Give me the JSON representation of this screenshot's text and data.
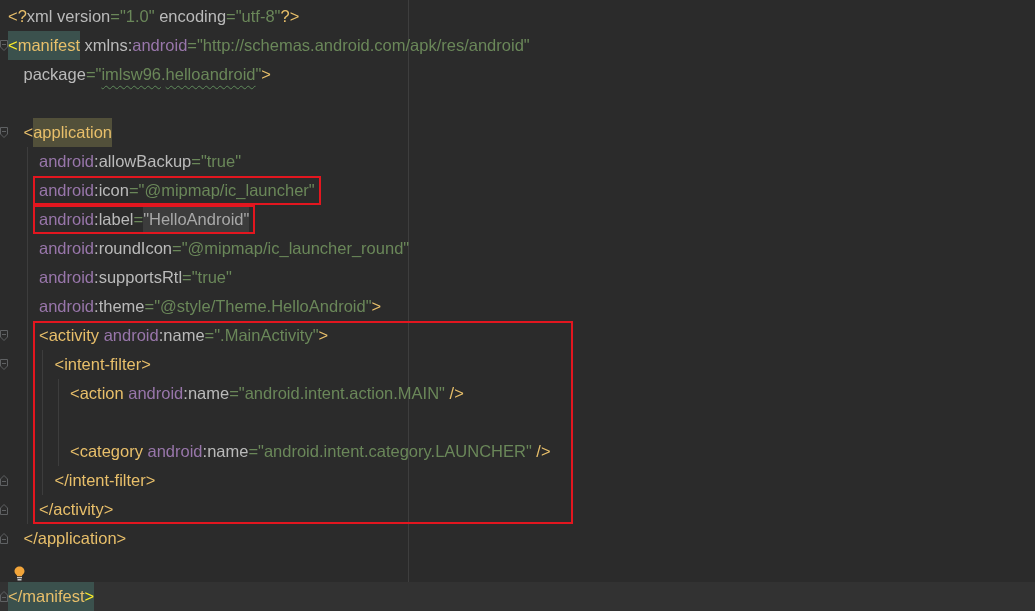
{
  "editor": {
    "lines": [
      {
        "kind": "line",
        "current": false,
        "tokens": [
          {
            "kind": "tag",
            "text": "<?"
          },
          {
            "kind": "attr",
            "text": "xml version"
          },
          {
            "kind": "value",
            "text": "=\"1.0\""
          },
          {
            "kind": "attr",
            "text": " encoding"
          },
          {
            "kind": "value",
            "text": "=\"utf-8\""
          },
          {
            "kind": "tag",
            "text": "?>"
          }
        ]
      },
      {
        "kind": "fold_start",
        "current": false,
        "tokens": [
          {
            "kind": "bracket_matched",
            "text": "<"
          },
          {
            "kind": "tag_matched",
            "text": "manifest"
          },
          {
            "kind": "attr",
            "text": " xmlns:"
          },
          {
            "kind": "ns",
            "text": "android"
          },
          {
            "kind": "value",
            "text": "=\"http://schemas.android.com/apk/res/android\""
          }
        ],
        "children": [
          {
            "kind": "line",
            "current": false,
            "tokens": [
              {
                "kind": "attr",
                "text": "package"
              },
              {
                "kind": "value",
                "text": "=\""
              },
              {
                "kind": "value_typo",
                "text": "imlsw96"
              },
              {
                "kind": "value",
                "text": "."
              },
              {
                "kind": "value_typo",
                "text": "helloandroid"
              },
              {
                "kind": "value",
                "text": "\""
              },
              {
                "kind": "tag",
                "text": ">"
              }
            ]
          },
          {
            "kind": "blank",
            "bulb": false
          },
          {
            "kind": "fold_start",
            "current": false,
            "tokens": [
              {
                "kind": "tag",
                "text": "<"
              },
              {
                "kind": "tag_usage",
                "text": "application"
              }
            ],
            "children": [
              {
                "kind": "line",
                "current": false,
                "tokens": [
                  {
                    "kind": "ns",
                    "text": "android"
                  },
                  {
                    "kind": "attr",
                    "text": ":allowBackup"
                  },
                  {
                    "kind": "value",
                    "text": "=\"true\""
                  }
                ]
              },
              {
                "kind": "frame",
                "lines": [
                  {
                    "kind": "line",
                    "current": false,
                    "tokens": [
                      {
                        "kind": "ns",
                        "text": "android"
                      },
                      {
                        "kind": "attr",
                        "text": ":icon"
                      },
                      {
                        "kind": "value",
                        "text": "=\"@mipmap/ic_launcher\""
                      }
                    ]
                  }
                ]
              },
              {
                "kind": "frame",
                "lines": [
                  {
                    "kind": "line",
                    "current": false,
                    "tokens": [
                      {
                        "kind": "ns",
                        "text": "android"
                      },
                      {
                        "kind": "attr",
                        "text": ":label"
                      },
                      {
                        "kind": "value",
                        "text": "="
                      },
                      {
                        "kind": "string_folded",
                        "text": "\"HelloAndroid\""
                      }
                    ]
                  }
                ]
              },
              {
                "kind": "line",
                "current": false,
                "tokens": [
                  {
                    "kind": "ns",
                    "text": "android"
                  },
                  {
                    "kind": "attr",
                    "text": ":roundIcon"
                  },
                  {
                    "kind": "value",
                    "text": "=\"@mipmap/ic_launcher_round\""
                  }
                ]
              },
              {
                "kind": "line",
                "current": false,
                "tokens": [
                  {
                    "kind": "ns",
                    "text": "android"
                  },
                  {
                    "kind": "attr",
                    "text": ":supportsRtl"
                  },
                  {
                    "kind": "value",
                    "text": "=\"true\""
                  }
                ]
              },
              {
                "kind": "line",
                "current": false,
                "tokens": [
                  {
                    "kind": "ns",
                    "text": "android"
                  },
                  {
                    "kind": "attr",
                    "text": ":theme"
                  },
                  {
                    "kind": "value",
                    "text": "=\"@style/Theme.HelloAndroid\""
                  },
                  {
                    "kind": "tag",
                    "text": ">"
                  }
                ]
              },
              {
                "kind": "frame",
                "lines": [
                  {
                    "kind": "fold_start",
                    "current": false,
                    "tokens": [
                      {
                        "kind": "tag",
                        "text": "<activity"
                      },
                      {
                        "kind": "ns",
                        "text": " android"
                      },
                      {
                        "kind": "attr",
                        "text": ":name"
                      },
                      {
                        "kind": "value",
                        "text": "=\".MainActivity\""
                      },
                      {
                        "kind": "tag",
                        "text": ">"
                      }
                    ],
                    "children": [
                      {
                        "kind": "fold_start",
                        "current": false,
                        "tokens": [
                          {
                            "kind": "tag",
                            "text": "<intent-filter>"
                          }
                        ],
                        "children": [
                          {
                            "kind": "line",
                            "current": false,
                            "tokens": [
                              {
                                "kind": "tag",
                                "text": "<action"
                              },
                              {
                                "kind": "ns",
                                "text": " android"
                              },
                              {
                                "kind": "attr",
                                "text": ":name"
                              },
                              {
                                "kind": "value",
                                "text": "=\"android.intent.action.MAIN\""
                              },
                              {
                                "kind": "tag",
                                "text": " />"
                              }
                            ]
                          },
                          {
                            "kind": "blank",
                            "bulb": false
                          },
                          {
                            "kind": "line",
                            "current": false,
                            "tokens": [
                              {
                                "kind": "tag",
                                "text": "<category"
                              },
                              {
                                "kind": "ns",
                                "text": " android"
                              },
                              {
                                "kind": "attr",
                                "text": ":name"
                              },
                              {
                                "kind": "value",
                                "text": "=\"android.intent.category.LAUNCHER\""
                              },
                              {
                                "kind": "tag",
                                "text": " />"
                              }
                            ]
                          }
                        ]
                      },
                      {
                        "kind": "fold_end",
                        "current": false,
                        "tokens": [
                          {
                            "kind": "tag",
                            "text": "</intent-filter>"
                          }
                        ]
                      }
                    ]
                  },
                  {
                    "kind": "fold_end",
                    "current": false,
                    "tokens": [
                      {
                        "kind": "tag",
                        "text": "</activity>"
                      }
                    ]
                  }
                ]
              }
            ]
          },
          {
            "kind": "fold_end",
            "current": false,
            "tokens": [
              {
                "kind": "tag",
                "text": "</application>"
              }
            ]
          }
        ]
      },
      {
        "kind": "blank",
        "bulb": true
      },
      {
        "kind": "fold_end",
        "current": true,
        "tokens": [
          {
            "kind": "tag_matched",
            "text": "</manifest"
          },
          {
            "kind": "bracket_matched",
            "text": ">"
          }
        ]
      }
    ]
  }
}
